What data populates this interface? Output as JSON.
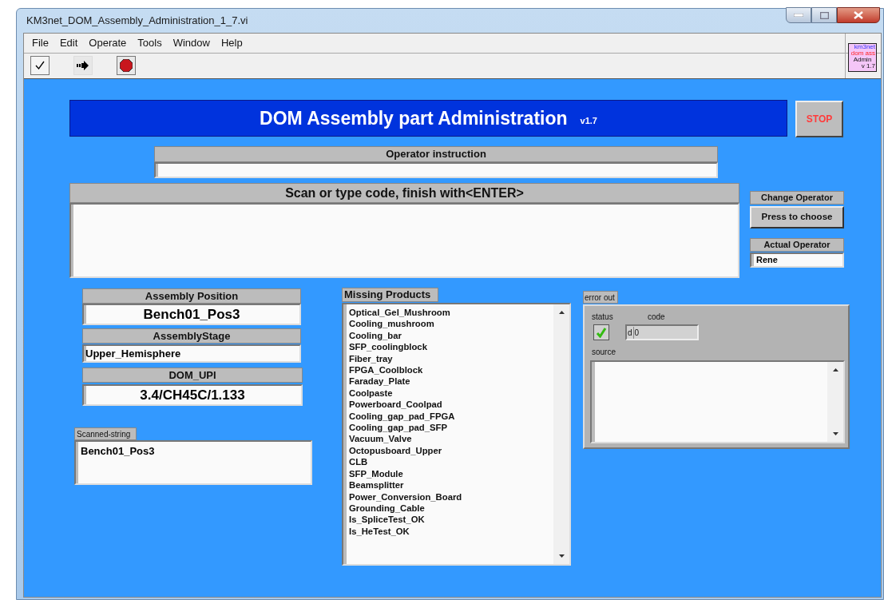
{
  "window": {
    "title": "KM3net_DOM_Assembly_Administration_1_7.vi"
  },
  "menu": [
    "File",
    "Edit",
    "Operate",
    "Tools",
    "Window",
    "Help"
  ],
  "vi_icon": {
    "lines": [
      "km3net",
      "dom ass",
      "Admin",
      "v 1.7"
    ]
  },
  "banner": {
    "title": "DOM Assembly part Administration",
    "version": "v1.7"
  },
  "stop_button": "STOP",
  "operator_instruction": {
    "label": "Operator instruction"
  },
  "scan": {
    "label": "Scan or type code, finish with<ENTER>"
  },
  "change_operator": {
    "label": "Change Operator",
    "button": "Press to choose"
  },
  "actual_operator": {
    "label": "Actual Operator",
    "value": "Rene"
  },
  "assembly_position": {
    "label": "Assembly Position",
    "value": "Bench01_Pos3"
  },
  "assembly_stage": {
    "label": "AssemblyStage",
    "value": "Upper_Hemisphere"
  },
  "dom_upi": {
    "label": "DOM_UPI",
    "value": "3.4/CH45C/1.133"
  },
  "scanned_string": {
    "label": "Scanned-string",
    "value": "Bench01_Pos3"
  },
  "missing_products": {
    "label": "Missing Products",
    "items": [
      "Optical_Gel_Mushroom",
      "Cooling_mushroom",
      "Cooling_bar",
      "SFP_coolingblock",
      "Fiber_tray",
      "FPGA_Coolblock",
      "Faraday_Plate",
      "Coolpaste",
      "Powerboard_Coolpad",
      "Cooling_gap_pad_FPGA",
      "Cooling_gap_pad_SFP",
      "Vacuum_Valve",
      "Octopusboard_Upper",
      "CLB",
      "SFP_Module",
      "Beamsplitter",
      "Power_Conversion_Board",
      "Grounding_Cable",
      "Is_SpliceTest_OK",
      "Is_HeTest_OK"
    ]
  },
  "error_out": {
    "label": "error out",
    "status_label": "status",
    "status_checked": true,
    "code_label": "code",
    "code_radix": "d",
    "code_value": "0",
    "source_label": "source"
  }
}
